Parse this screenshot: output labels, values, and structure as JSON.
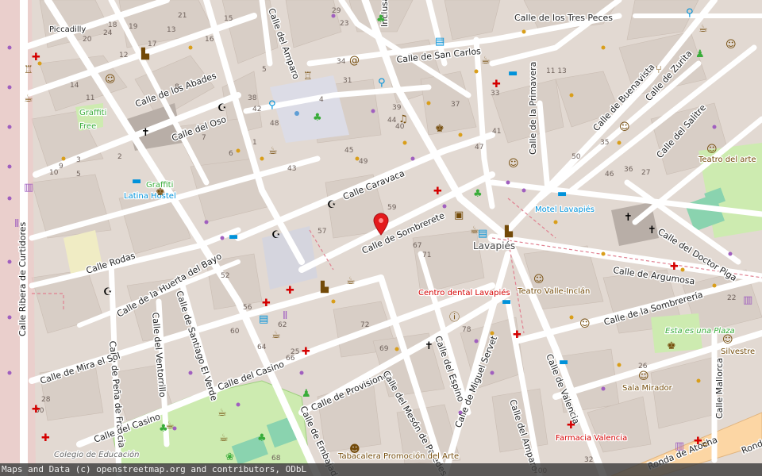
{
  "map": {
    "colors": {
      "background": "#e2d9d2",
      "building": "#d9cfc7",
      "street": "#ffffff",
      "pedestrian": "#dddde8",
      "park": "#cdebb0",
      "primary_road": "#fcd6a4",
      "water": "#aad3df",
      "poi_green": "#39ac39",
      "poi_red": "#d40000",
      "poi_brown": "#734a08",
      "poi_blue": "#0092da",
      "poi_purple": "#a05fbf"
    },
    "streets": [
      "Calle de los Tres Peces",
      "Calle de San Carlos",
      "Calle del Amparo",
      "Calle de los Abades",
      "Calle del Oso",
      "Calle Caravaca",
      "Calle de Sombrerete",
      "Calle Rodas",
      "Calle de la Huerta del Bayo",
      "Calle de Santiago El Verde",
      "Calle del Ventorrillo",
      "Calle de Peña de Francia",
      "Calle de Mira el Sol",
      "Calle del Casino",
      "Calle del Casino",
      "Calle de Provisiones",
      "Calle del Mesón de Paredes",
      "Calle del Espino",
      "Calle de Miguel Servet",
      "Calle del Amparo",
      "Calle de Valencia",
      "Calle de Argumosa",
      "Calle de la Sombrerería",
      "Calle del Doctor Piga",
      "Calle del Salitre",
      "Calle de Zurita",
      "Calle de Buenavista",
      "Calle de la Primavera",
      "Calle Ribera de Curtidores",
      "Calle de Embajadores",
      "Calle Mallorca",
      "Inclusa",
      "Ronda de Atocha",
      "Ronda"
    ],
    "places": {
      "piccadilly": "Piccadilly",
      "graffiti1": "Graffiti",
      "free": "Free",
      "graffiti2": "Graffiti",
      "latina_hostel": "Latina Hostel",
      "motel_lavapies": "Motel Lavapiés",
      "lavapies": "Lavapiés",
      "teatro_valle": "Teatro Valle-Inclán",
      "centro_dental": "Centro dental Lavapiés",
      "esta_es_una_plaza": "Esta es una Plaza",
      "silvestre": "Silvestre",
      "sala_mirador": "Sala Mirador",
      "farmacia_valencia": "Farmacia Valencia",
      "teatro_del_arte": "Teatro del arte",
      "tabacalera": "Tabacalera Promoción del Arte",
      "colegio": "Colegio de Educación"
    },
    "house_numbers": [
      "29",
      "23",
      "19",
      "20",
      "24",
      "13",
      "18",
      "21",
      "16",
      "17",
      "12",
      "15",
      "14",
      "11",
      "10",
      "9",
      "8",
      "7",
      "6",
      "5",
      "4",
      "3",
      "2",
      "1",
      "33",
      "34",
      "35",
      "36",
      "37",
      "38",
      "39",
      "41",
      "42",
      "43",
      "44",
      "45",
      "46",
      "47",
      "48",
      "49",
      "50",
      "52",
      "56",
      "57",
      "59",
      "60",
      "62",
      "64",
      "66",
      "67",
      "68",
      "69",
      "71",
      "72",
      "78",
      "100",
      "32",
      "30",
      "28",
      "26",
      "25",
      "22",
      "27",
      "31",
      "40",
      "11 13",
      "5"
    ],
    "marker": {
      "label": "location marker"
    }
  },
  "attribution": "Maps and Data (c) openstreetmap.org and contributors, ODbL"
}
